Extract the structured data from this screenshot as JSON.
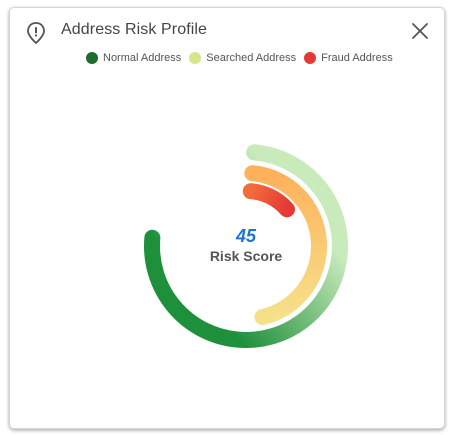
{
  "dialog": {
    "title": "Address Risk Profile",
    "close_icon": "close-icon",
    "pin_icon": "location-pin-icon"
  },
  "legend": [
    {
      "label": "Normal Address",
      "color": "#1b6e2e"
    },
    {
      "label": "Searched Address",
      "color": "#d4e88a"
    },
    {
      "label": "Fraud Address",
      "color": "#e53935"
    }
  ],
  "score": {
    "value": "45",
    "label": "Risk Score"
  },
  "chart_data": {
    "type": "radial_bar",
    "max_angle_deg": 360,
    "series": [
      {
        "name": "Normal Address",
        "value": 75,
        "color_start": "#1e8f3a",
        "color_end": "#c9eabb"
      },
      {
        "name": "Searched Address",
        "value": 45,
        "color_start": "#f6e08a",
        "color_end": "#ffb05a"
      },
      {
        "name": "Fraud Address",
        "value": 12,
        "color_start": "#e53935",
        "color_end": "#f26b3a"
      }
    ]
  }
}
